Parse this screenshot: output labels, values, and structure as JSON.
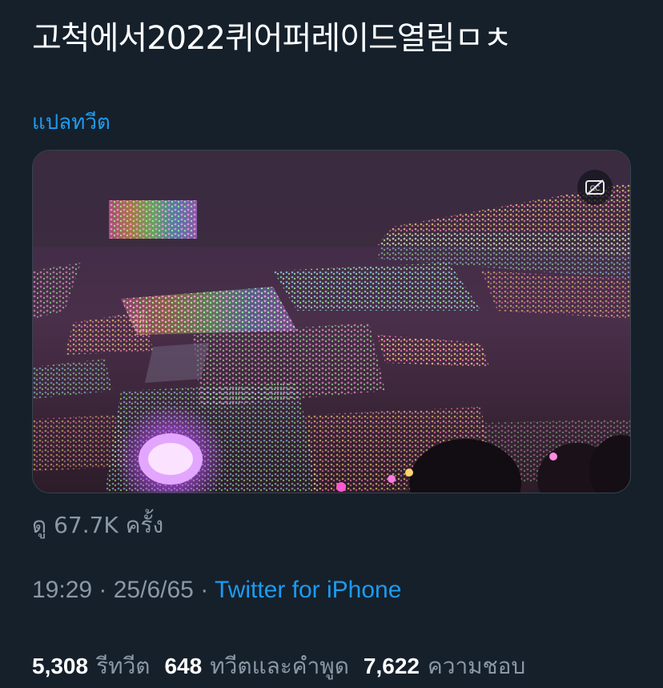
{
  "tweet": {
    "text": "고척에서2022퀴어퍼레이드열림ㅁㅊ",
    "translate_label": "แปลทวีต"
  },
  "media": {
    "type": "video",
    "captions_icon": "captions-off-icon"
  },
  "views": {
    "label": "ดู 67.7K ครั้ง"
  },
  "meta": {
    "time": "19:29",
    "date": "25/6/65",
    "separator": "·",
    "source": "Twitter for iPhone"
  },
  "stats": [
    {
      "count": "5,308",
      "label": "รีทวีต"
    },
    {
      "count": "648",
      "label": "ทวีตและคำพูด"
    },
    {
      "count": "7,622",
      "label": "ความชอบ"
    }
  ],
  "colors": {
    "background": "#15202b",
    "text_primary": "#ffffff",
    "text_secondary": "#8b98a5",
    "link": "#1d9bf0"
  }
}
